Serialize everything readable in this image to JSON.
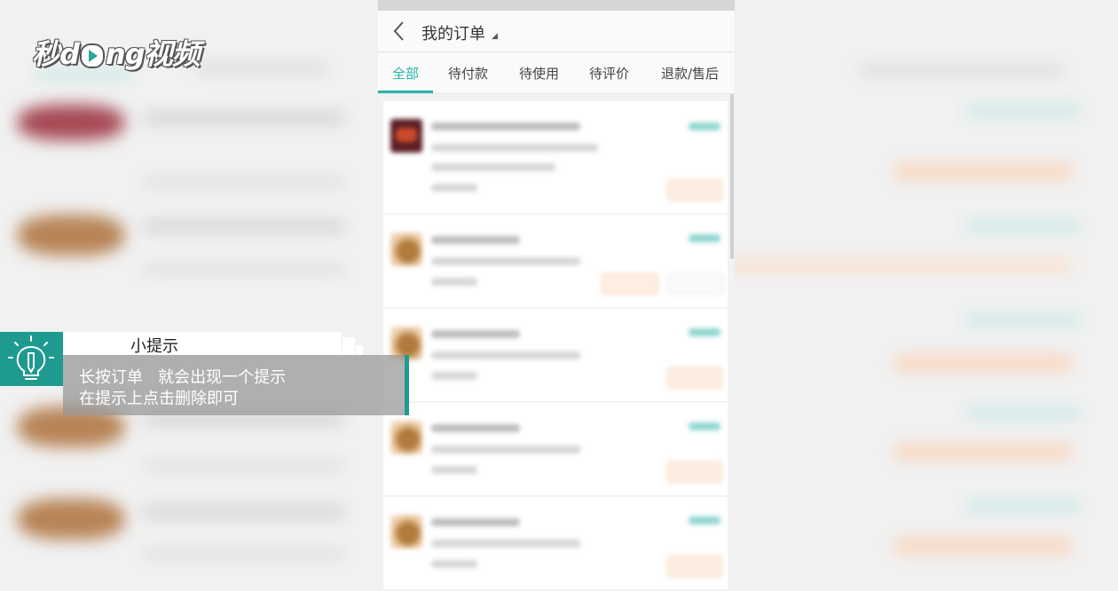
{
  "watermark": {
    "logo_text_a": "秒",
    "logo_text_b": "d",
    "logo_text_c": "ng",
    "logo_text_d": "视频"
  },
  "header": {
    "back_icon": "chevron-left-icon",
    "title": "我的订单",
    "title_caret": "◢"
  },
  "tabs": [
    {
      "label": "全部",
      "active": true
    },
    {
      "label": "待付款",
      "active": false
    },
    {
      "label": "待使用",
      "active": false
    },
    {
      "label": "待评价",
      "active": false
    },
    {
      "label": "退款/售后",
      "active": false
    }
  ],
  "tip": {
    "icon": "lightbulb-pencil-icon",
    "header": "小提示",
    "line1": "长按订单   就会出现一个提示",
    "line2": "在提示上点击删除即可"
  },
  "colors": {
    "accent": "#25b5a8",
    "tip_teal": "#1f9a8f",
    "action_orange": "#f4c9a8"
  }
}
